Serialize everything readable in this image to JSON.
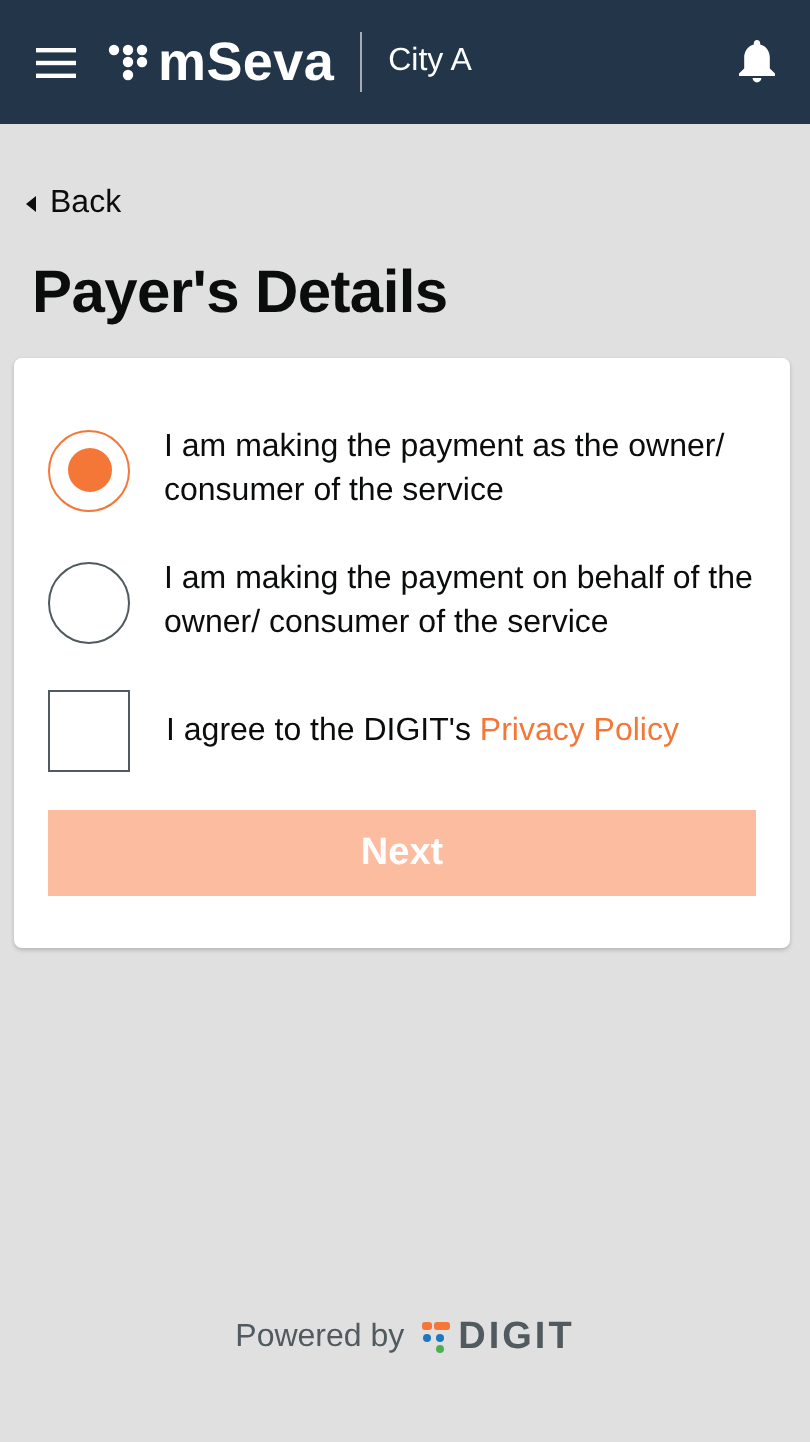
{
  "header": {
    "app_name": "mSeva",
    "city": "City A"
  },
  "back": {
    "label": "Back"
  },
  "title": "Payer's Details",
  "options": [
    {
      "label": "I am making the payment as the owner/ consumer of the service",
      "selected": true
    },
    {
      "label": "I am making the payment on behalf of the owner/ consumer of the service",
      "selected": false
    }
  ],
  "agreement": {
    "text": "I agree to the DIGIT's",
    "link": "Privacy Policy",
    "checked": false
  },
  "next_button": {
    "label": "Next",
    "disabled": true
  },
  "footer": {
    "text": "Powered by",
    "brand": "DIGIT"
  }
}
